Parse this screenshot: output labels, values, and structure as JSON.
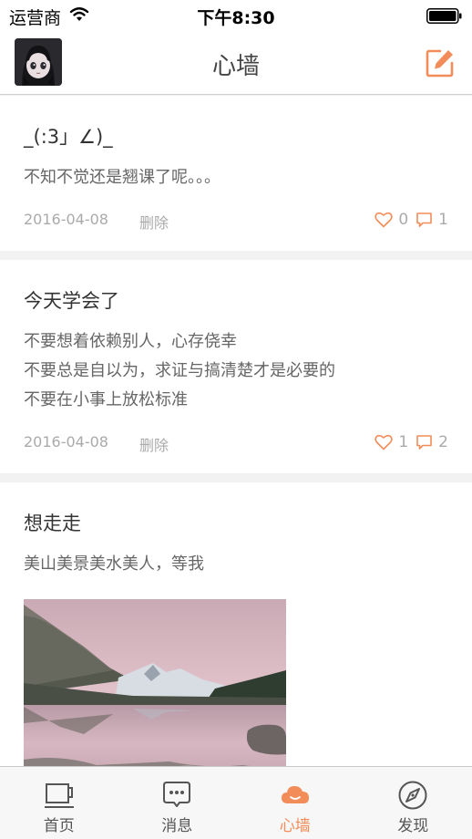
{
  "status_bar": {
    "carrier": "运营商",
    "time": "下午8:30"
  },
  "header": {
    "title": "心墙"
  },
  "posts": [
    {
      "title": "_(:3」∠)_",
      "body": [
        "不知不觉还是翘课了呢。。。"
      ],
      "date": "2016-04-08",
      "delete_label": "删除",
      "likes": "0",
      "comments": "1"
    },
    {
      "title": "今天学会了",
      "body": [
        "不要想着依赖别人，心存侥幸",
        "不要总是自以为，求证与搞清楚才是必要的",
        "不要在小事上放松标准"
      ],
      "date": "2016-04-08",
      "delete_label": "删除",
      "likes": "1",
      "comments": "2"
    },
    {
      "title": "想走走",
      "body": [
        "美山美景美水美人，等我"
      ]
    }
  ],
  "tabs": [
    {
      "label": "首页",
      "icon": "cup-icon",
      "active": false
    },
    {
      "label": "消息",
      "icon": "chat-bubble-icon",
      "active": false
    },
    {
      "label": "心墙",
      "icon": "cloud-icon",
      "active": true
    },
    {
      "label": "发现",
      "icon": "compass-icon",
      "active": false
    }
  ],
  "colors": {
    "accent": "#f28d5a",
    "inactive": "#555555",
    "muted": "#aaaaaa"
  }
}
